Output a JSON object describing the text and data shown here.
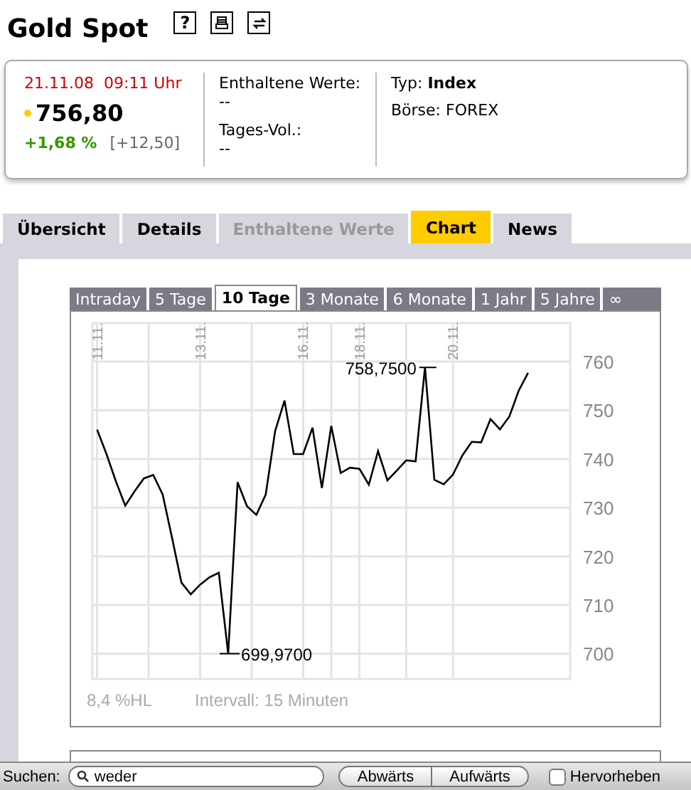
{
  "title": "Gold Spot",
  "header_buttons": [
    {
      "kind": "help",
      "label": "?"
    },
    {
      "kind": "print"
    },
    {
      "kind": "refresh"
    }
  ],
  "quote": {
    "date": "21.11.08",
    "time": "09:11 Uhr",
    "price": "756,80",
    "change_pct": "+1,68 %",
    "change_abs": "[+12,50]"
  },
  "info": [
    {
      "label": "Enthaltene Werte:",
      "value": "--"
    },
    {
      "label": "Tages-Vol.:",
      "value": "--"
    }
  ],
  "meta": [
    "Typ: **Index**",
    "Börse: FOREX"
  ],
  "tabs": [
    {
      "label": "Übersicht",
      "selected": false,
      "disabled": false
    },
    {
      "label": "Details",
      "selected": false,
      "disabled": false
    },
    {
      "label": "Enthaltene Werte",
      "selected": false,
      "disabled": true
    },
    {
      "label": "Chart",
      "selected": true,
      "disabled": false
    },
    {
      "label": "News",
      "selected": false,
      "disabled": false
    }
  ],
  "periods": [
    {
      "label": "Intraday",
      "selected": false
    },
    {
      "label": "5 Tage",
      "selected": false
    },
    {
      "label": "10 Tage",
      "selected": true
    },
    {
      "label": "3 Monate",
      "selected": false
    },
    {
      "label": "6 Monate",
      "selected": false
    },
    {
      "label": "1 Jahr",
      "selected": false
    },
    {
      "label": "5 Jahre",
      "selected": false
    },
    {
      "label": "∞",
      "selected": false
    }
  ],
  "chart": {
    "chart_data": {
      "type": "line",
      "categories": [
        "11.11.",
        null,
        null,
        null,
        null,
        null,
        null,
        null,
        null,
        null,
        null,
        "13.11.",
        null,
        null,
        null,
        null,
        null,
        null,
        null,
        null,
        null,
        null,
        "16.11.",
        null,
        null,
        null,
        null,
        null,
        "18.11.",
        null,
        null,
        null,
        null,
        null,
        null,
        null,
        null,
        null,
        "20.11.",
        null,
        null,
        null,
        null,
        null,
        null,
        null,
        null,
        null,
        null,
        null,
        null
      ],
      "series": [
        {
          "color": "#000000",
          "values": [
            746,
            741,
            735.4,
            730.4,
            733.3,
            736,
            736.7,
            732.7,
            723.8,
            714.6,
            712.2,
            714.2,
            715.7,
            716.6,
            700,
            735.2,
            730.3,
            728.5,
            732.7,
            745.7,
            752,
            741,
            741,
            746.4,
            734,
            746.8,
            737.1,
            738.2,
            738,
            734.7,
            741.6,
            735.6,
            737.6,
            739.7,
            739.5,
            758.8,
            735.7,
            734.8,
            736.8,
            740.7,
            743.5,
            743.4,
            748.2,
            746.1,
            748.7,
            754,
            757.7,
            null,
            null,
            null,
            null
          ]
        }
      ],
      "ylim": [
        694.8,
        767.9
      ],
      "grid": true,
      "yticks": [
        700,
        710,
        720,
        730,
        740,
        750,
        760
      ],
      "annotations": [
        "758,7500",
        "699,9700"
      ]
    },
    "range": "8,4 %HL",
    "interval": "Intervall: 15 Minuten"
  },
  "find_bar": {
    "label": "Suchen:",
    "value": "weder",
    "buttons": [
      "Abwärts",
      "Aufwärts"
    ],
    "highlight": {
      "label": "Hervorheben",
      "checked": false
    }
  }
}
